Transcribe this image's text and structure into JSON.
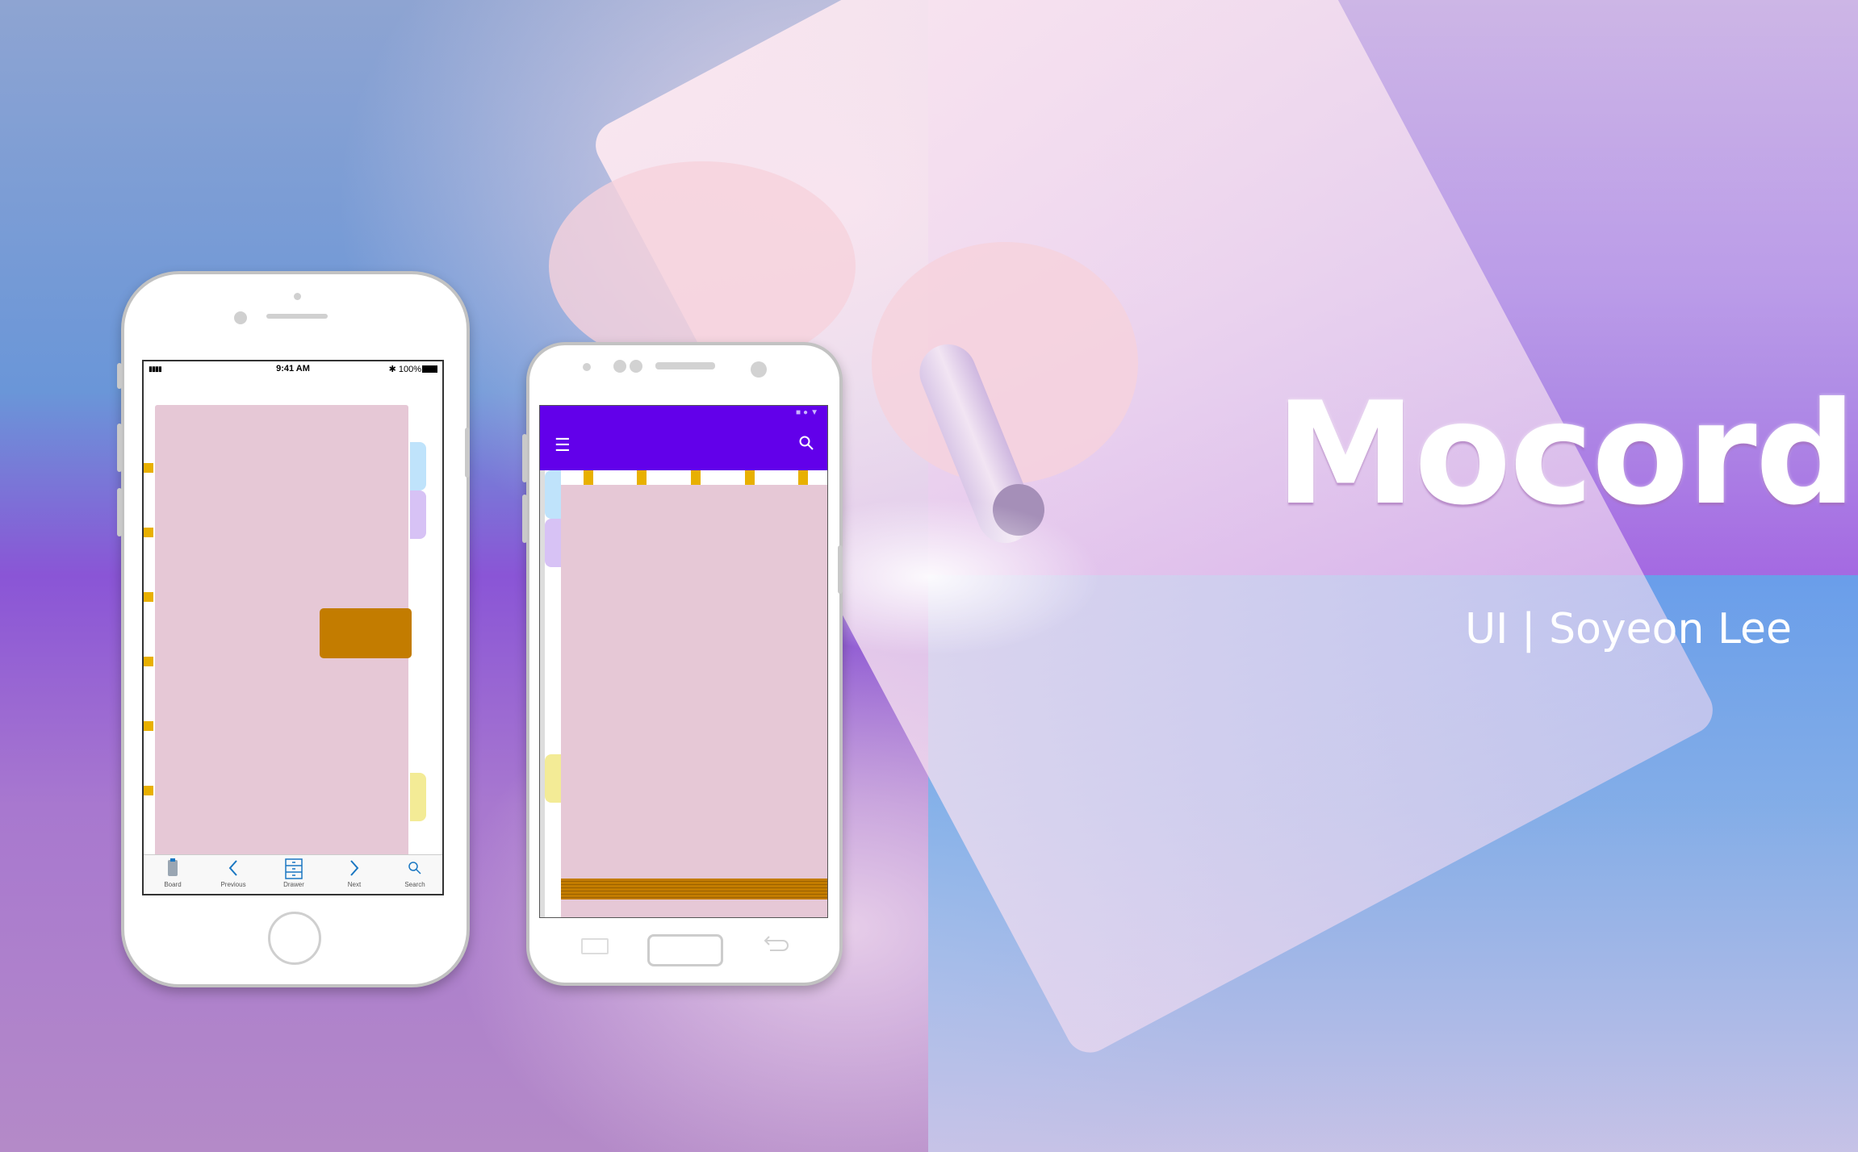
{
  "title": "Mocord",
  "subtitle": "UI | Soyeon Lee",
  "iphone": {
    "status": {
      "signal": "▮▮▮▮",
      "time": "9:41 AM",
      "battery": "✱ 100%"
    },
    "toolbar": [
      {
        "label": "Board",
        "icon": "board-icon"
      },
      {
        "label": "Previous",
        "icon": "chevron-left-icon"
      },
      {
        "label": "Drawer",
        "icon": "drawer-icon"
      },
      {
        "label": "Next",
        "icon": "chevron-right-icon"
      },
      {
        "label": "Search",
        "icon": "search-icon"
      }
    ]
  },
  "android": {
    "status_icons": "■●▼",
    "menu_glyph": "☰",
    "search_glyph": "⌕"
  },
  "colors": {
    "page": "#e6c8d6",
    "bookmark": "#c37c00",
    "ring": "#e8b000",
    "tab_blue": "#bfe3fb",
    "tab_purple": "#d7c2f5",
    "tab_yellow": "#f3eb96",
    "appbar": "#6200ea"
  }
}
